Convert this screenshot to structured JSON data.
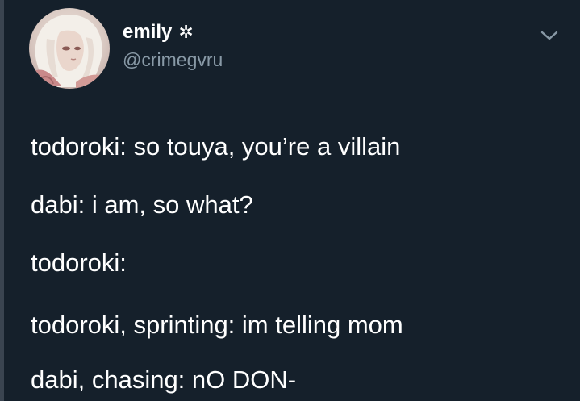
{
  "author": {
    "display_name": "emily",
    "name_decoration": "✲",
    "handle": "@crimegvru"
  },
  "icons": {
    "avatar": "user-avatar",
    "menu": "chevron-down-icon"
  },
  "colors": {
    "background": "#15202b",
    "text": "#ffffff",
    "handle_text": "#8899a6"
  },
  "tweet": {
    "lines": [
      "todoroki: so touya, you’re a villain",
      "dabi: i am, so what?",
      "todoroki:",
      "todoroki, sprinting: im telling mom",
      "dabi, chasing: nO DON-"
    ]
  }
}
